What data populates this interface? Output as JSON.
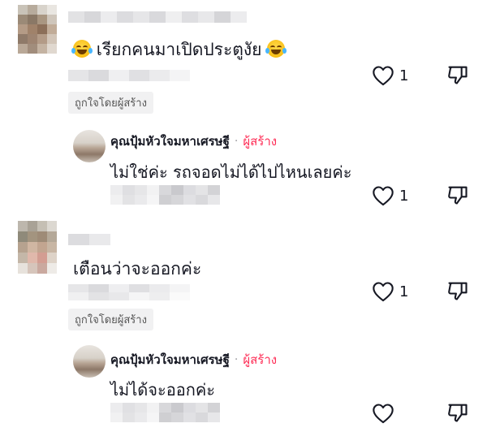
{
  "comments": [
    {
      "text": "เรียกคนมาเปิดประตูงัย",
      "emoji_left": "laughing-tears-emoji",
      "emoji_right": "laughing-tears-emoji",
      "like_count": "1",
      "liked_by_creator": "ถูกใจโดยผู้สร้าง",
      "reply": {
        "author": "คุณปุ้มหัวใจมหาเศรษฐี",
        "separator": "·",
        "creator_tag": "ผู้สร้าง",
        "text": "ไม่ใช่ค่ะ รถจอดไม่ได้ไปไหนเลยค่ะ",
        "like_count": "1"
      }
    },
    {
      "text": "เตือนว่าจะออกค่ะ",
      "like_count": "1",
      "liked_by_creator": "ถูกใจโดยผู้สร้าง",
      "reply": {
        "author": "คุณปุ้มหัวใจมหาเศรษฐี",
        "separator": "·",
        "creator_tag": "ผู้สร้าง",
        "text": "ไม่ได้จะออกค่ะ",
        "like_count": ""
      }
    }
  ],
  "icons": {
    "like": "heart-outline-icon",
    "dislike": "thumbs-down-outline-icon"
  },
  "colors": {
    "creator_tag": "#fe2c55",
    "text": "#161823",
    "badge_bg": "#f1f1f2"
  }
}
